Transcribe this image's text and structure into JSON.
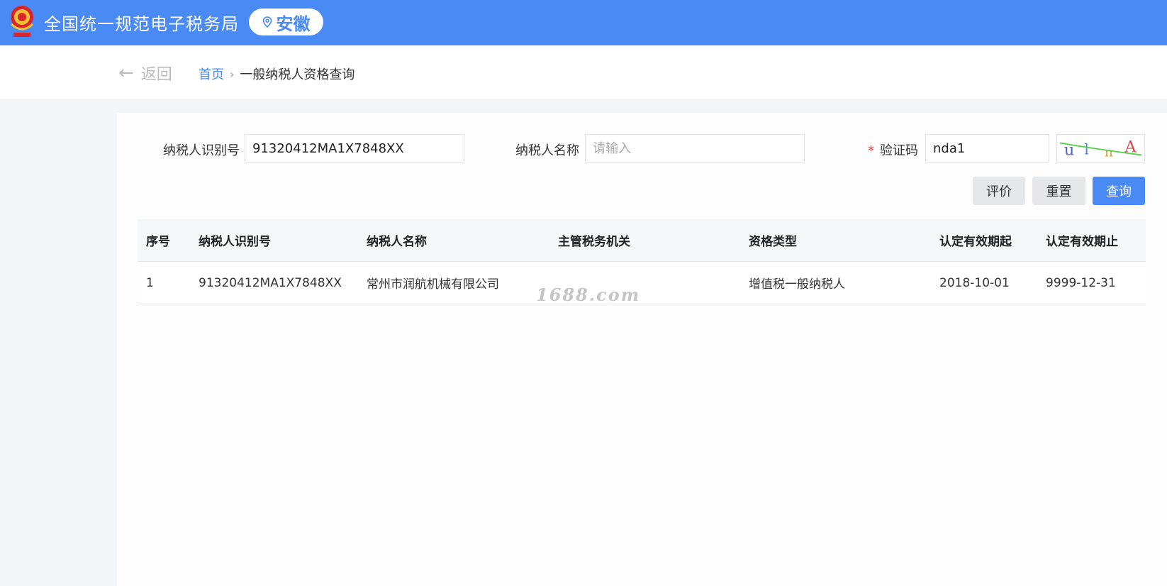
{
  "header": {
    "title": "全国统一规范电子税务局",
    "region": "安徽",
    "brand_color": "#4a8af4"
  },
  "nav": {
    "back_label": "返回",
    "breadcrumb": {
      "home": "首页",
      "separator": "›",
      "current": "一般纳税人资格查询"
    }
  },
  "form": {
    "taxpayer_id": {
      "label": "纳税人识别号",
      "value": "91320412MA1X7848XX"
    },
    "taxpayer_name": {
      "label": "纳税人名称",
      "value": "",
      "placeholder": "请输入"
    },
    "captcha": {
      "required_mark": "*",
      "label": "验证码",
      "value": "nda1",
      "image_text": "ulnA"
    }
  },
  "buttons": {
    "evaluate": "评价",
    "reset": "重置",
    "query": "查询"
  },
  "table": {
    "columns": [
      "序号",
      "纳税人识别号",
      "纳税人名称",
      "主管税务机关",
      "资格类型",
      "认定有效期起",
      "认定有效期止"
    ],
    "rows": [
      [
        "1",
        "91320412MA1X7848XX",
        "常州市润航机械有限公司",
        "",
        "增值税一般纳税人",
        "2018-10-01",
        "9999-12-31"
      ]
    ]
  },
  "watermark": "1688.com"
}
